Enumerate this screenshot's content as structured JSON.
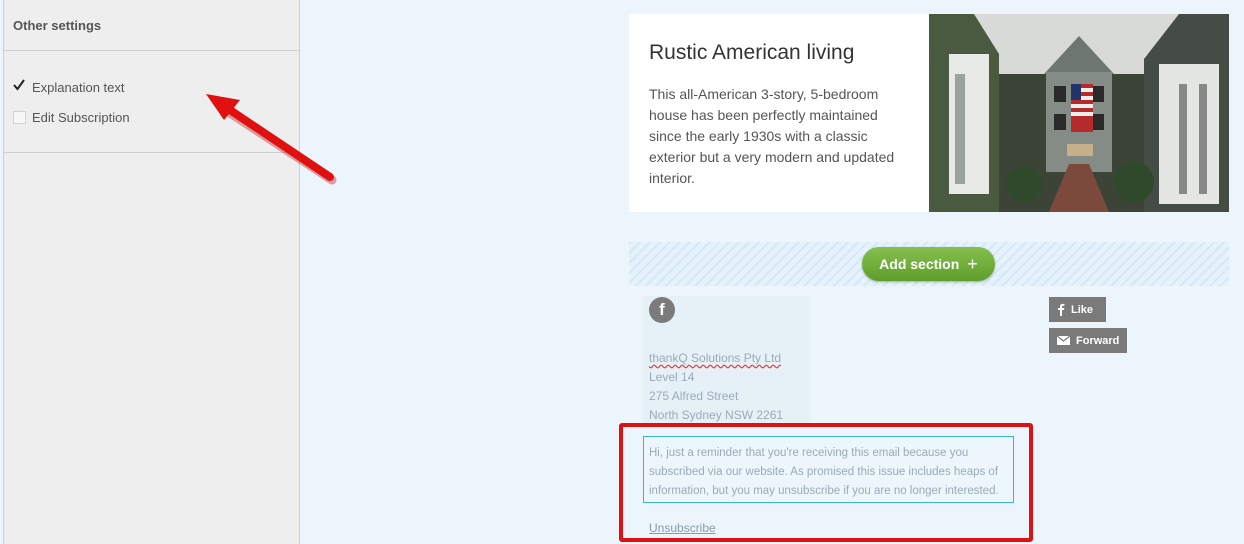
{
  "panel": {
    "title": "Other settings",
    "options": [
      {
        "label": "Explanation text",
        "checked": true
      },
      {
        "label": "Edit Subscription",
        "checked": false
      }
    ]
  },
  "email": {
    "card_title": "Rustic American living",
    "card_text": "This all-American 3-story, 5-bedroom house has been perfectly maintained since the early 1930s with a classic exterior but a very modern and updated interior.",
    "photo_icon": "house-photo",
    "add_section_label": "Add section",
    "add_section_icon": "plus-icon",
    "facebook_icon": "facebook-icon",
    "facebook_letter": "f",
    "address": [
      "thankQ Solutions Pty Ltd",
      "Level 14",
      "275 Alfred Street",
      "North Sydney NSW 2261"
    ],
    "like_label": "Like",
    "forward_label": "Forward",
    "explanation": "Hi, just a reminder that you're receiving this email because you subscribed via our website. As promised this issue includes heaps of information, but you may unsubscribe if you are no longer interested.",
    "unsubscribe": "Unsubscribe"
  },
  "colors": {
    "accent_green": "#6aab38",
    "highlight_red": "#dd1111",
    "box_border": "#39b3d7"
  }
}
